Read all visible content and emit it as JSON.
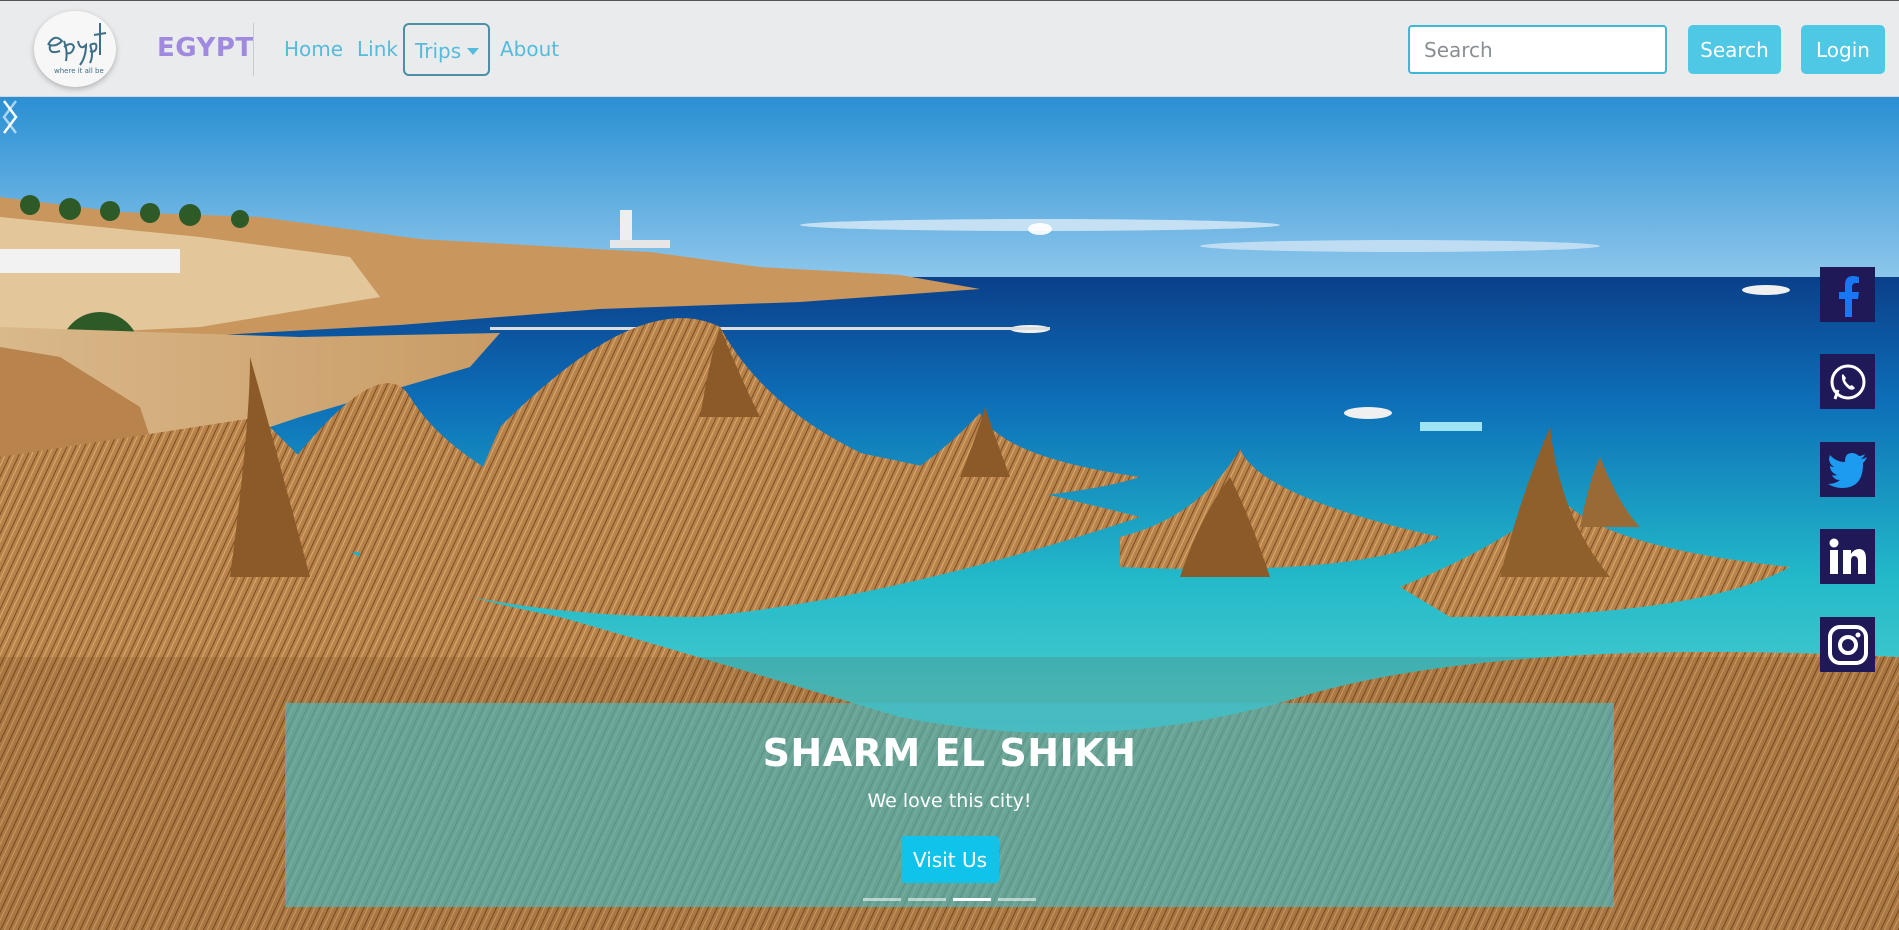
{
  "navbar": {
    "brand": "EGYPT",
    "logo": {
      "icon": "egypt-logo",
      "text": "egypt",
      "tagline": "where it all be"
    },
    "links": {
      "home": "Home",
      "link": "Link",
      "trips": "Trips",
      "about": "About"
    },
    "search": {
      "placeholder": "Search",
      "value": ""
    },
    "search_button": "Search",
    "login_button": "Login"
  },
  "hero": {
    "slide": {
      "title": "SHARM EL SHIKH",
      "subtitle": "We love this city!",
      "button": "Visit Us"
    },
    "indicators": {
      "count": 4,
      "active_index": 2
    },
    "controls": {
      "prev_icon": "chevron-left-icon",
      "next_icon": "chevron-right-icon"
    }
  },
  "social": [
    {
      "name": "facebook-icon"
    },
    {
      "name": "whatsapp-icon"
    },
    {
      "name": "twitter-icon"
    },
    {
      "name": "linkedin-icon"
    },
    {
      "name": "instagram-icon"
    }
  ],
  "colors": {
    "accent": "#4ec8e4",
    "brand": "#a08adf",
    "social_bg": "#1f1a57",
    "caption_bg": "#42bec8"
  }
}
